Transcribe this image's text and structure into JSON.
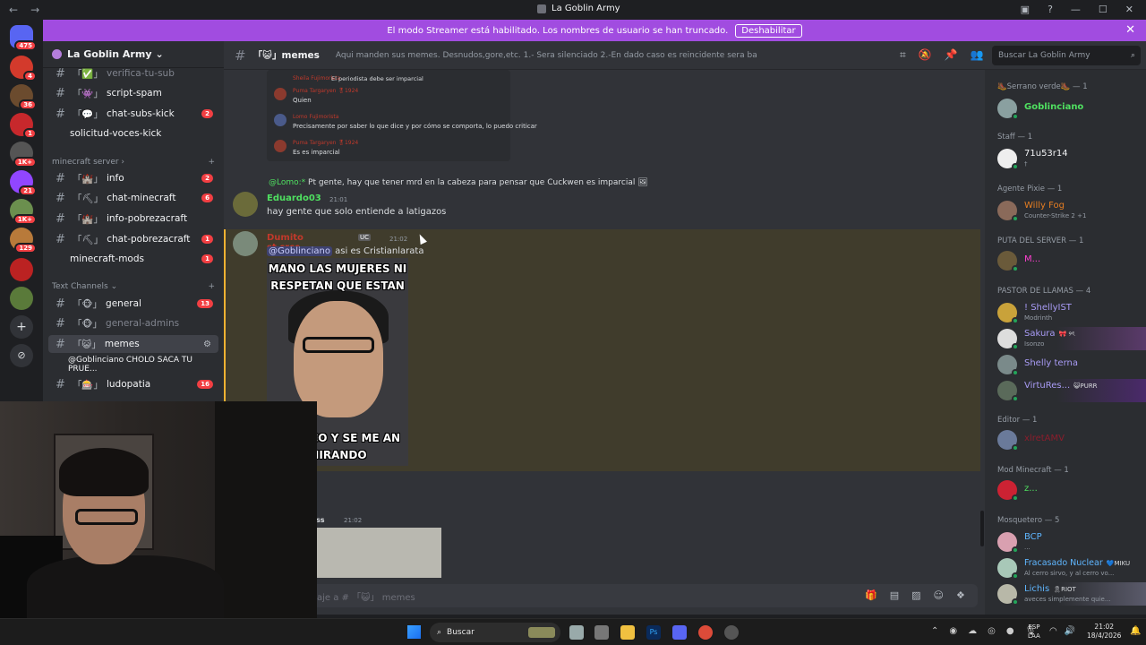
{
  "window": {
    "title": "La Goblin Army",
    "nav_back": "←",
    "nav_forward": "→",
    "controls": [
      "▣",
      "?",
      "—",
      "☐",
      "✕"
    ]
  },
  "banner": {
    "text": "El modo Streamer está habilitado. Los nombres de usuario se han truncado.",
    "button": "Deshabilitar",
    "close": "✕"
  },
  "servers": [
    {
      "badge": "475"
    },
    {
      "badge": "4"
    },
    {
      "badge": "36"
    },
    {
      "badge": "1"
    },
    {
      "badge": "1K+"
    },
    {
      "badge": "21"
    },
    {
      "badge": "1K+"
    },
    {
      "badge": "129"
    },
    {
      "badge": ""
    },
    {
      "badge": ""
    }
  ],
  "server": {
    "name": "La Goblin Army",
    "chevron": "⌄"
  },
  "channels": {
    "items": [
      {
        "emoji": "「✅」",
        "label": "verifica-tu-sub",
        "badge": ""
      },
      {
        "emoji": "「👾」",
        "label": "script-spam",
        "badge": ""
      },
      {
        "emoji": "「💬」",
        "label": "chat-subs-kick",
        "badge": "2"
      },
      {
        "emoji": "",
        "label": "solicitud-voces-kick",
        "badge": ""
      },
      {
        "emoji": "「🏰」",
        "label": "info",
        "badge": "2"
      },
      {
        "emoji": "「⛏」",
        "label": "chat-minecraft",
        "badge": "6"
      },
      {
        "emoji": "「🏰」",
        "label": "info-pobrezacraft",
        "badge": ""
      },
      {
        "emoji": "「⛏」",
        "label": "chat-pobrezacraft",
        "badge": "1"
      },
      {
        "emoji": "",
        "label": "minecraft-mods",
        "badge": "1"
      },
      {
        "emoji": "「🐵」",
        "label": "general",
        "badge": "13"
      },
      {
        "emoji": "「🐵」",
        "label": "general-admins",
        "badge": ""
      },
      {
        "emoji": "「😺」",
        "label": "memes",
        "badge": ""
      },
      {
        "emoji": "「🎰」",
        "label": "ludopatia",
        "badge": "16"
      }
    ],
    "categories": {
      "minecraft": "minecraft server",
      "text": "Text Channels"
    },
    "thread": "@Goblinciano CHOLO SACA TU PRUE..."
  },
  "header": {
    "channel": "「😺」memes",
    "topic": "Aqui manden sus memes. Desnudos,gore,etc. 1.- Sera silenciado 2.-En dado caso es reincidente sera baneado",
    "search_placeholder": "Buscar La Goblin Army"
  },
  "chat": {
    "quoted": [
      {
        "name": "Sheila Fujimorista",
        "text": "El periodista debe ser imparcial"
      },
      {
        "name": "Puma Targaryen 🎖1924",
        "time": "20:55",
        "text": "Quien"
      },
      {
        "name": "Lomo Fujimorista",
        "time": "20:55",
        "text": "Precisamente por saber lo que dice y por cómo se comporta, lo puedo criticar"
      },
      {
        "name": "Puma Targaryen 🎖1924",
        "time": "20:55",
        "text": "Es es imparcial"
      }
    ],
    "reply_ref": "@Lomo:*",
    "reply_text": "Pt gente, hay que tener mrd en la cabeza para pensar que Cuckwen es imparcial",
    "msg1": {
      "user": "Eduardo03",
      "time": "21:01",
      "text": "hay gente que solo entiende a latigazos"
    },
    "msg2": {
      "user": "Dumito st crcc",
      "badge": "UC",
      "time": "21:02",
      "mention": "@Goblinciano",
      "text": "asi es Cristianlarata"
    },
    "meme_top": "MANO LAS MUJERES NI RESPETAN QUE ESTAN",
    "meme_bottom": "O FLACO Y SE ME AN MIRANDO",
    "msg3": {
      "user": "ss",
      "time": "21:02"
    }
  },
  "input": {
    "placeholder": "aje a # 「😺」 memes"
  },
  "members": {
    "groups": [
      {
        "role": "🥾Serrano verde🥾 — 1",
        "members": [
          {
            "name": "Goblinciano",
            "color": "#4fe060",
            "sub": ""
          }
        ]
      },
      {
        "role": "Staff — 1",
        "members": [
          {
            "name": "71u53r14",
            "color": "#f2f3f5",
            "sub": "†"
          }
        ]
      },
      {
        "role": "Agente Pixie — 1",
        "members": [
          {
            "name": "Willy Fog",
            "color": "#e67e22",
            "sub": "Counter-Strike 2 +1"
          }
        ]
      },
      {
        "role": "PUTA DEL SERVER — 1",
        "members": [
          {
            "name": "M...",
            "color": "#ff3fd1",
            "sub": ""
          }
        ]
      },
      {
        "role": "PASTOR DE LLAMAS — 4",
        "members": [
          {
            "name": "! ShellyIST",
            "color": "#a89bf5",
            "sub": "Modrinth"
          },
          {
            "name": "Sakura",
            "color": "#a89bf5",
            "sub": "Isonzo",
            "tag": "🎀 ୨ৎ"
          },
          {
            "name": "Shelly terna",
            "color": "#a89bf5",
            "sub": ""
          },
          {
            "name": "VirtuRes...",
            "color": "#a89bf5",
            "sub": "",
            "tag": "😺PURR"
          }
        ]
      },
      {
        "role": "Editor — 1",
        "members": [
          {
            "name": "xlretAMV",
            "color": "#8b1d2c",
            "sub": ""
          }
        ]
      },
      {
        "role": "Mod Minecraft — 1",
        "members": [
          {
            "name": "z...",
            "color": "#4fe060",
            "sub": ""
          }
        ]
      },
      {
        "role": "Mosquetero — 5",
        "members": [
          {
            "name": "BCP",
            "color": "#5fb6ff",
            "sub": "..."
          },
          {
            "name": "Fracasado Nuclear",
            "color": "#5fb6ff",
            "sub": "Al cerro sirvo, y al cerro vo...",
            "tag": "💙MIKU"
          },
          {
            "name": "Lichis",
            "color": "#5fb6ff",
            "sub": "aveces simplemente quie...",
            "tag": "🎗RIOT"
          }
        ]
      }
    ]
  },
  "taskbar": {
    "search": "Buscar",
    "lang1": "ESP",
    "lang2": "LAA",
    "time": "21:02",
    "date": "18/4/2026"
  },
  "colors": {
    "banner": "#a14ce0",
    "accent": "#5865f2",
    "mention_bg": "#403c2c"
  }
}
